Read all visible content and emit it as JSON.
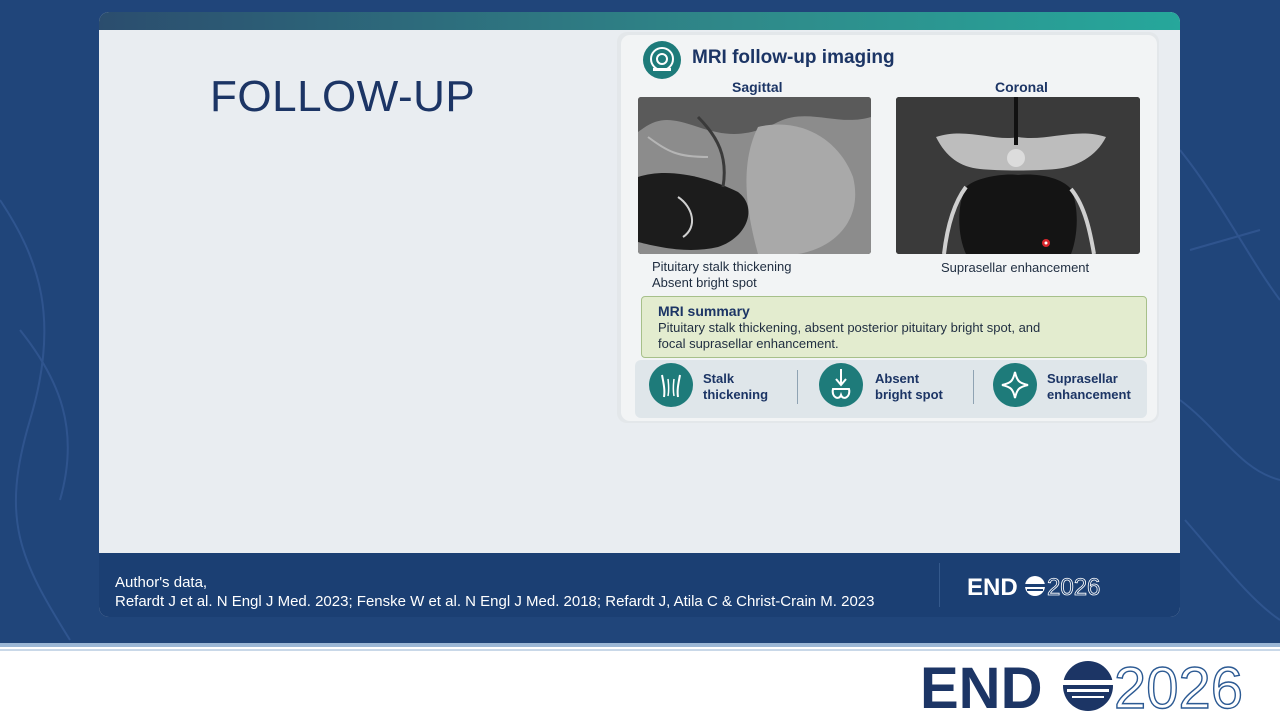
{
  "slide": {
    "title": "FOLLOW-UP",
    "references": {
      "line1": "Author's data,",
      "line2": "Refardt J et al. N Engl J Med. 2023; Fenske W et al. N Engl J Med. 2018; Refardt J, Atila C & Christ-Crain M. 2023"
    },
    "logo": {
      "prefix": "END",
      "year": "2026"
    }
  },
  "panel": {
    "title": "MRI follow-up imaging",
    "header_icon": "mri-scanner-icon",
    "images": [
      {
        "label": "Sagittal",
        "caption_lines": [
          "Pituitary stalk thickening",
          "Absent bright spot"
        ]
      },
      {
        "label": "Coronal",
        "caption_lines": [
          "Suprasellar enhancement"
        ]
      }
    ],
    "summary": {
      "title": "MRI summary",
      "text": "Pituitary stalk thickening, absent posterior pituitary bright spot, and focal suprasellar enhancement."
    },
    "features": [
      {
        "icon": "stalk-icon",
        "label_lines": [
          "Stalk",
          "thickening"
        ]
      },
      {
        "icon": "pituitary-icon",
        "label_lines": [
          "Absent",
          "bright spot"
        ]
      },
      {
        "icon": "sparkle-icon",
        "label_lines": [
          "Suprasellar",
          "enhancement"
        ]
      }
    ]
  },
  "bottom_logo": {
    "prefix": "END",
    "year": "2026"
  },
  "colors": {
    "navy": "#1c3565",
    "teal": "#1e7b7a",
    "footer": "#1b3f73",
    "summary_bg": "#e3eccf"
  }
}
